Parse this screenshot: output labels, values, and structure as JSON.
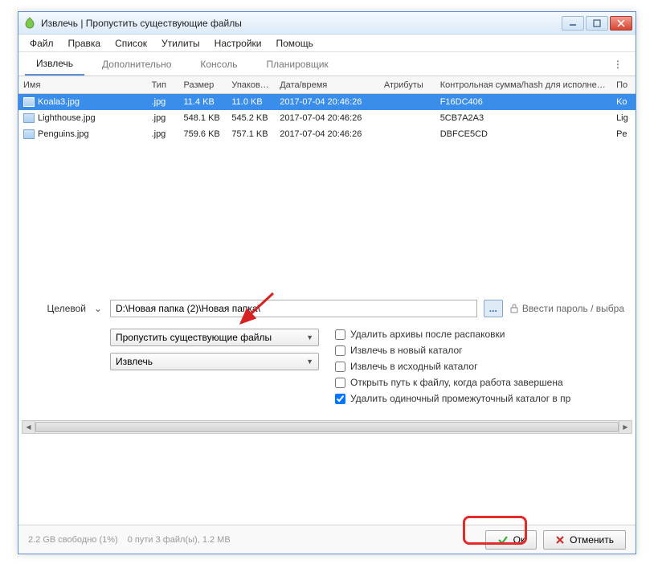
{
  "window": {
    "title": "Извлечь | Пропустить существующие файлы"
  },
  "menu": {
    "file": "Файл",
    "edit": "Правка",
    "list": "Список",
    "utils": "Утилиты",
    "settings": "Настройки",
    "help": "Помощь"
  },
  "tabs": {
    "extract": "Извлечь",
    "advanced": "Дополнительно",
    "console": "Консоль",
    "scheduler": "Планировщик"
  },
  "columns": {
    "name": "Имя",
    "type": "Тип",
    "size": "Размер",
    "packed": "Упаковано",
    "date": "Дата/время",
    "attr": "Атрибуты",
    "hash": "Контрольная сумма/hash для исполнения",
    "ext": "По"
  },
  "files": [
    {
      "name": "Koala3.jpg",
      "type": ".jpg",
      "size": "11.4 KB",
      "packed": "11.0 KB",
      "date": "2017-07-04 20:46:26",
      "hash": "F16DC406",
      "ext": "Ko"
    },
    {
      "name": "Lighthouse.jpg",
      "type": ".jpg",
      "size": "548.1 KB",
      "packed": "545.2 KB",
      "date": "2017-07-04 20:46:26",
      "hash": "5CB7A2A3",
      "ext": "Lig"
    },
    {
      "name": "Penguins.jpg",
      "type": ".jpg",
      "size": "759.6 KB",
      "packed": "757.1 KB",
      "date": "2017-07-04 20:46:26",
      "hash": "DBFCE5CD",
      "ext": "Pe"
    }
  ],
  "target": {
    "label": "Целевой",
    "path": "D:\\Новая папка (2)\\Новая папка\\",
    "browse": "...",
    "password": "Ввести пароль / выбра"
  },
  "combos": {
    "skip": "Пропустить существующие файлы",
    "extract": "Извлечь"
  },
  "checkboxes": {
    "delete_after": "Удалить архивы после распаковки",
    "extract_new": "Извлечь в новый каталог",
    "extract_src": "Извлечь в исходный каталог",
    "open_path": "Открыть путь к файлу, когда работа завершена",
    "remove_inter": "Удалить одиночный промежуточный каталог в пр"
  },
  "status": {
    "free": "2.2 GB свободно (1%)",
    "path": "0 пути 3 файл(ы), 1.2 MB"
  },
  "buttons": {
    "ok": "Ок",
    "cancel": "Отменить"
  }
}
